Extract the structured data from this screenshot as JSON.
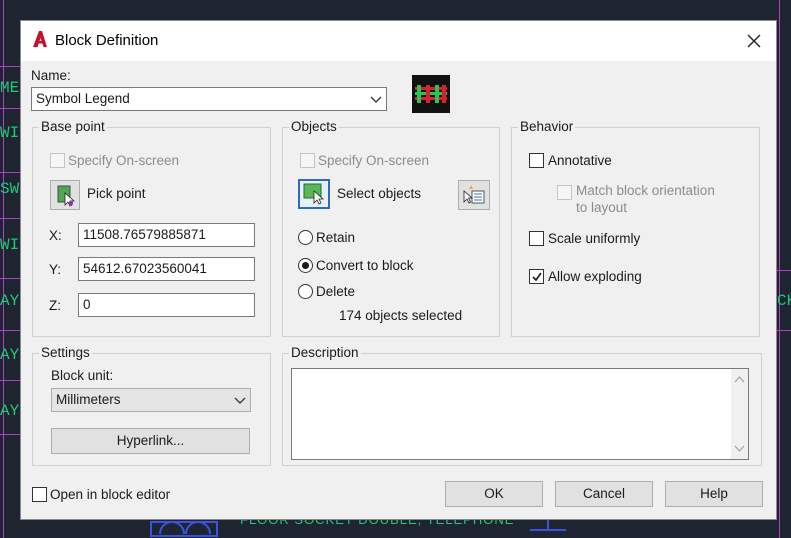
{
  "window": {
    "title": "Block Definition"
  },
  "name": {
    "label": "Name:",
    "value": "Symbol Legend"
  },
  "base_point": {
    "title": "Base point",
    "specify_onscreen": "Specify On-screen",
    "pick_point": "Pick point",
    "x_label": "X:",
    "x_value": "11508.76579885871",
    "y_label": "Y:",
    "y_value": "54612.67023560041",
    "z_label": "Z:",
    "z_value": "0"
  },
  "objects": {
    "title": "Objects",
    "specify_onscreen": "Specify On-screen",
    "select_objects": "Select objects",
    "retain": "Retain",
    "convert_to_block": "Convert to block",
    "delete": "Delete",
    "selected_count": "174 objects selected",
    "selected_option": "convert_to_block"
  },
  "behavior": {
    "title": "Behavior",
    "annotative": "Annotative",
    "match_orientation": "Match block orientation",
    "match_orientation_2": "to layout",
    "scale_uniformly": "Scale uniformly",
    "allow_exploding": "Allow exploding",
    "annotative_checked": false,
    "scale_uniformly_checked": false,
    "allow_exploding_checked": true
  },
  "settings": {
    "title": "Settings",
    "block_unit_label": "Block unit:",
    "block_unit_value": "Millimeters",
    "hyperlink": "Hyperlink..."
  },
  "description": {
    "title": "Description",
    "value": ""
  },
  "footer": {
    "open_in_editor": "Open in block editor",
    "ok": "OK",
    "cancel": "Cancel",
    "help": "Help"
  },
  "background": {
    "left_labels": [
      "ME",
      "WIT",
      "SW",
      "WIT",
      "AY S",
      "AY",
      "AY S"
    ],
    "right_label": "CK",
    "bottom_text": "FLOOR SOCKET DOUBLE, TELEPHONE"
  },
  "colors": {
    "accent": "#2f6cb5",
    "cad_text": "#1fc87a",
    "cad_lines": "#b040c8",
    "app_icon": "#c8102e"
  }
}
